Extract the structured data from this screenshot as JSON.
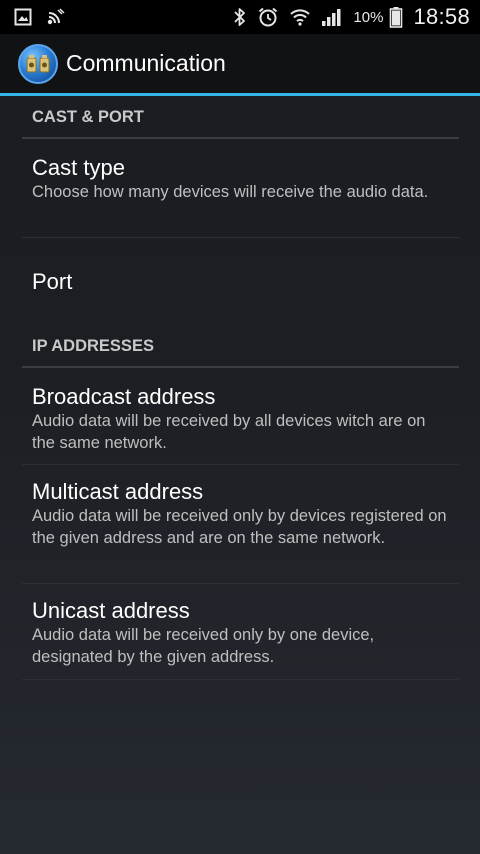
{
  "status_bar": {
    "left_icons": [
      "image-notification-icon",
      "cast-notification-icon"
    ],
    "right_icons": [
      "bluetooth-icon",
      "alarm-icon",
      "wifi-icon",
      "signal-icon"
    ],
    "battery_percent": "10%",
    "time": "18:58"
  },
  "action_bar": {
    "title": "Communication",
    "accent_color": "#33b5e5"
  },
  "sections": [
    {
      "header": "CAST & PORT",
      "items": [
        {
          "title": "Cast type",
          "summary": "Choose how many devices will receive the audio data."
        },
        {
          "title": "Port",
          "summary": ""
        }
      ]
    },
    {
      "header": "IP ADDRESSES",
      "items": [
        {
          "title": "Broadcast address",
          "summary": "Audio data will be received by all devices witch are on the same network."
        },
        {
          "title": "Multicast address",
          "summary": "Audio data will be received only by devices registered on the given address and are on the same network."
        },
        {
          "title": "Unicast address",
          "summary": "Audio data will be received only by one device, designated by the given address."
        }
      ]
    }
  ]
}
